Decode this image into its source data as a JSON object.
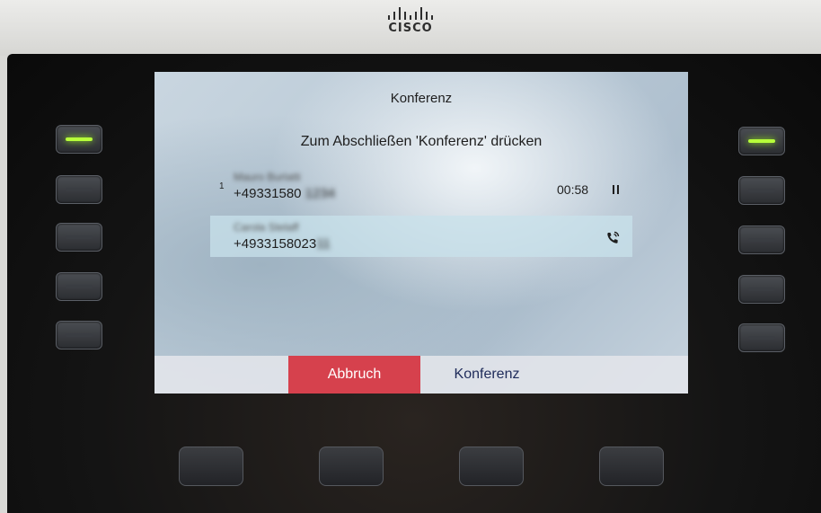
{
  "brand": {
    "logo_text": "CISCO"
  },
  "screen": {
    "title": "Konferenz",
    "instruction": "Zum Abschließen 'Konferenz' drücken",
    "calls": [
      {
        "index": "1",
        "name": "Mauro Burlatti",
        "number_visible": "+49331580",
        "number_hidden": "1234",
        "timer": "00:58",
        "state_icon": "pause-icon"
      },
      {
        "index": "",
        "name": "Carola Stelaff",
        "number_visible": "+4933158023",
        "number_hidden": "11",
        "timer": "",
        "state_icon": "phone-ringing-icon"
      }
    ],
    "softkeys": {
      "cancel": "Abbruch",
      "conference": "Konferenz"
    }
  },
  "line_keys": {
    "left_lit": [
      true,
      false,
      false,
      false,
      false
    ],
    "right_lit": [
      true,
      false,
      false,
      false,
      false
    ]
  },
  "colors": {
    "cancel": "#d6414d",
    "led": "#b7ff3a"
  }
}
